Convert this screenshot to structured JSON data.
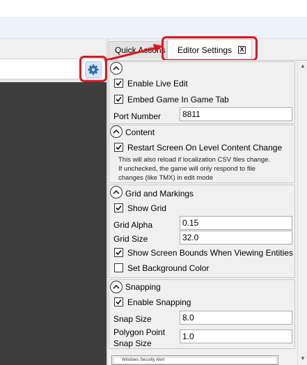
{
  "tabs": {
    "quick_actions": "Quick Actions",
    "editor_settings": "Editor Settings",
    "close_glyph": "X"
  },
  "icons": {
    "settings": "gear-icon",
    "collapse": "chevron-up-icon",
    "check": "checkmark-icon",
    "tab_close": "close-icon"
  },
  "colors": {
    "highlight": "#e0141e",
    "gear": "#2f6db5",
    "dark_viewport": "#3e3e3e"
  },
  "sections": {
    "live_edit": {
      "enable_live_edit": {
        "label": "Enable Live Edit",
        "checked": true
      },
      "embed_game": {
        "label": "Embed Game In Game Tab",
        "checked": true
      },
      "port": {
        "label": "Port Number",
        "value": "8811"
      }
    },
    "content": {
      "title": "Content",
      "restart_screen": {
        "label": "Restart Screen On Level Content Change",
        "checked": true
      },
      "note_line1": "This will also reload if localization CSV files change.",
      "note_line2": "If unchecked, the game will only respond to file",
      "note_line3": "changes (like TMX) in edit mode"
    },
    "grid": {
      "title": "Grid and Markings",
      "show_grid": {
        "label": "Show Grid",
        "checked": true
      },
      "alpha": {
        "label": "Grid Alpha",
        "value": "0.15"
      },
      "size": {
        "label": "Grid Size",
        "value": "32.0"
      },
      "screen_bounds": {
        "label": "Show Screen Bounds When Viewing Entities",
        "checked": true
      },
      "background_color": {
        "label": "Set Background Color",
        "checked": false
      }
    },
    "snapping": {
      "title": "Snapping",
      "enable_snapping": {
        "label": "Enable Snapping",
        "checked": true
      },
      "snap_size": {
        "label": "Snap Size",
        "value": "8.0"
      },
      "polygon_snap_line1": "Polygon Point",
      "polygon_snap_line2": "Snap Size",
      "polygon_snap_value": "1.0"
    }
  },
  "thumbnail": {
    "caption": "Windows Security Alert"
  }
}
